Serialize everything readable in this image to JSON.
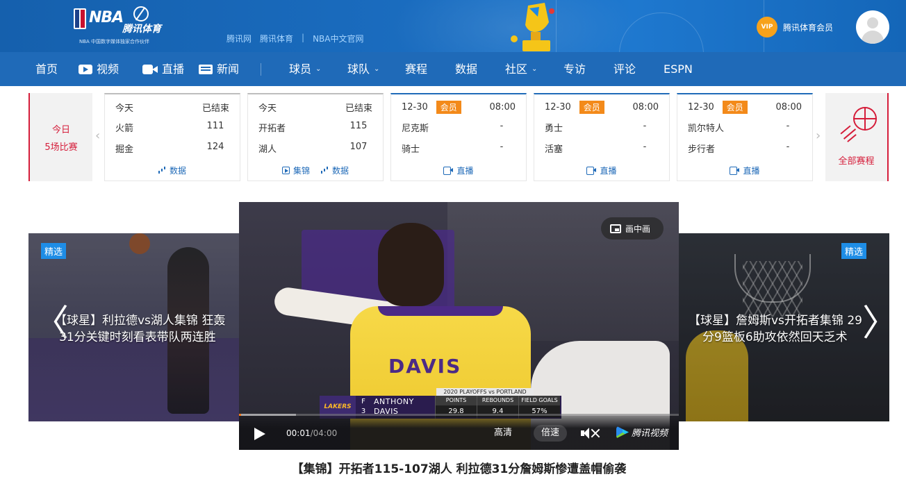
{
  "header": {
    "logo_nba": "NBA",
    "logo_brand": "腾讯体育",
    "logo_sub": "NBA 中国数字媒体独家合作伙伴",
    "links": [
      "腾讯网",
      "腾讯体育",
      "|",
      "NBA中文官网"
    ],
    "vip_badge": "VIP",
    "vip_label": "腾讯体育会员"
  },
  "nav": {
    "items": [
      {
        "label": "首页"
      },
      {
        "label": "视频",
        "icon": "video-icon"
      },
      {
        "label": "直播",
        "icon": "camera-icon"
      },
      {
        "label": "新闻",
        "icon": "news-icon"
      },
      {
        "label": "球员",
        "caret": "⌄"
      },
      {
        "label": "球队",
        "caret": "⌄"
      },
      {
        "label": "赛程"
      },
      {
        "label": "数据"
      },
      {
        "label": "社区",
        "caret": "⌄"
      },
      {
        "label": "专访"
      },
      {
        "label": "评论"
      },
      {
        "label": "ESPN"
      }
    ]
  },
  "schedule": {
    "today_line1": "今日",
    "today_line2": "5场比赛",
    "prev_arrow": "‹",
    "next_arrow": "›",
    "all_label": "全部赛程",
    "games": [
      {
        "date": "今天",
        "badge": "",
        "status": "已结束",
        "home": "火箭",
        "home_score": "111",
        "away": "掘金",
        "away_score": "124",
        "links": [
          "数据"
        ]
      },
      {
        "date": "今天",
        "badge": "",
        "status": "已结束",
        "home": "开拓者",
        "home_score": "115",
        "away": "湖人",
        "away_score": "107",
        "links": [
          "集锦",
          "数据"
        ]
      },
      {
        "date": "12-30",
        "badge": "会员",
        "status": "08:00",
        "home": "尼克斯",
        "home_score": "-",
        "away": "骑士",
        "away_score": "-",
        "links": [
          "直播"
        ]
      },
      {
        "date": "12-30",
        "badge": "会员",
        "status": "08:00",
        "home": "勇士",
        "home_score": "-",
        "away": "活塞",
        "away_score": "-",
        "links": [
          "直播"
        ]
      },
      {
        "date": "12-30",
        "badge": "会员",
        "status": "08:00",
        "home": "凯尔特人",
        "home_score": "-",
        "away": "步行者",
        "away_score": "-",
        "links": [
          "直播"
        ]
      }
    ]
  },
  "carousel": {
    "left": {
      "tag": "精选",
      "title_line1": "【球星】利拉德vs湖人集锦 狂轰",
      "title_line2": "31分关键时刻看表带队两连胜"
    },
    "right": {
      "tag": "精选",
      "title_line1": "【球星】詹姆斯vs开拓者集锦 29",
      "title_line2": "分9篮板6助攻依然回天乏术"
    },
    "prev_chevron": "〈",
    "next_chevron": "〉"
  },
  "video": {
    "jersey_name": "DAVIS",
    "pip_label": "画中画",
    "scorebug": {
      "top": "2020 PLAYOFFS vs PORTLAND",
      "team": "LAKERS",
      "pos": "F",
      "number": "3",
      "first": "ANTHONY",
      "last": "DAVIS",
      "stats": [
        {
          "label": "POINTS",
          "value": "29.8"
        },
        {
          "label": "REBOUNDS",
          "value": "9.4"
        },
        {
          "label": "FIELD GOALS",
          "value": "57%"
        }
      ]
    },
    "current_time": "00:01",
    "duration": "/04:00",
    "progress_played": 0.004,
    "progress_buffered": 0.13,
    "quality_label": "高清",
    "speed_label": "倍速",
    "brand": "腾讯视频",
    "caption": "【集锦】开拓者115-107湖人 利拉德31分詹姆斯惨遭盖帽偷袭"
  },
  "colors": {
    "header_blue": "#1a6cbf",
    "nav_blue": "#1f6ab8",
    "accent_red": "#d51d3a",
    "badge_orange": "#f38a1a",
    "tag_blue": "#1e8de6",
    "progress_orange": "#ff7a1a"
  }
}
